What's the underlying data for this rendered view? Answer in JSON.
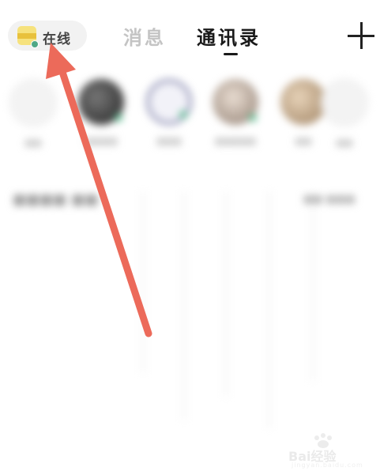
{
  "header": {
    "status_label": "在线",
    "tabs": [
      {
        "label": "消息",
        "active": false
      },
      {
        "label": "通讯录",
        "active": true
      }
    ],
    "add_icon": "plus-icon"
  },
  "colors": {
    "active_tab": "#1a1a1a",
    "inactive_tab": "#c4c4c4",
    "online_dot": "#4fa886",
    "annotation_arrow": "#ec6a5a"
  },
  "watermark": {
    "text": "Bai经验",
    "subtext": "jingyan.baidu.com"
  }
}
